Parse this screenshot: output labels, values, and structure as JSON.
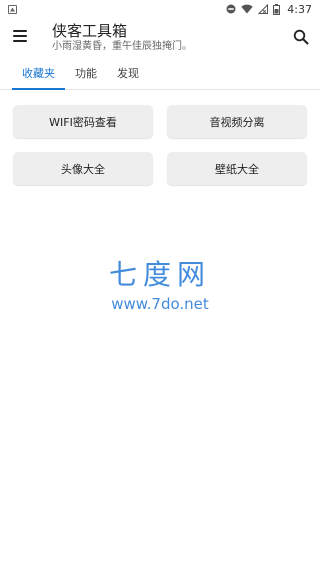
{
  "status_bar": {
    "time": "4:37",
    "notification_icon": "image-notification-icon",
    "icons": [
      "do-not-disturb-icon",
      "wifi-icon",
      "no-signal-icon",
      "battery-icon"
    ]
  },
  "app_bar": {
    "title": "侠客工具箱",
    "subtitle": "小雨湿黄昏，重午佳辰独掩门。",
    "menu_icon": "menu-icon",
    "search_icon": "search-icon"
  },
  "tabs": [
    {
      "label": "收藏夹",
      "active": true
    },
    {
      "label": "功能",
      "active": false
    },
    {
      "label": "发现",
      "active": false
    }
  ],
  "tools": [
    {
      "label": "WIFI密码查看"
    },
    {
      "label": "音视频分离"
    },
    {
      "label": "头像大全"
    },
    {
      "label": "壁纸大全"
    }
  ],
  "watermark": {
    "name": "七度网",
    "url": "www.7do.net"
  },
  "colors": {
    "accent": "#1976d2",
    "button_bg": "#eeeeee",
    "watermark": "#2f7fd8"
  }
}
